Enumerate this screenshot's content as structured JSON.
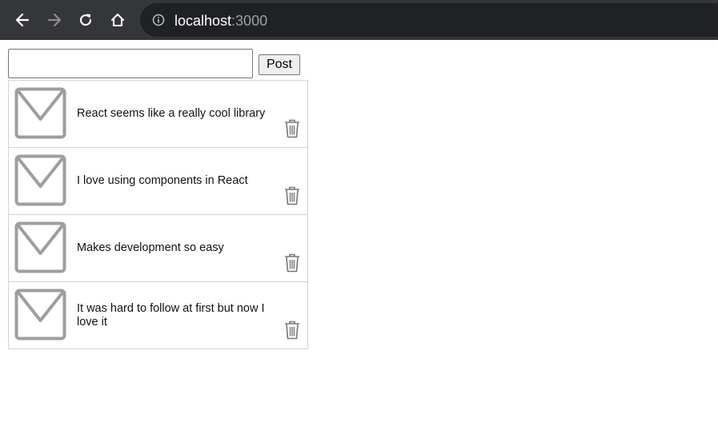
{
  "browser": {
    "url_host": "localhost",
    "url_port": ":3000",
    "icons": {
      "back": "arrow-left-icon",
      "forward": "arrow-right-icon",
      "reload": "reload-icon",
      "home": "home-icon",
      "info": "info-icon"
    }
  },
  "composer": {
    "input_value": "",
    "post_label": "Post"
  },
  "posts": [
    {
      "text": "React seems like a really cool library"
    },
    {
      "text": "I love using components in React"
    },
    {
      "text": "Makes development so easy"
    },
    {
      "text": "It was hard to follow at first but now I love it"
    }
  ],
  "colors": {
    "chrome_bg": "#35363a",
    "omnibox_bg": "#202124",
    "icon_gray": "#9e9e9e"
  }
}
